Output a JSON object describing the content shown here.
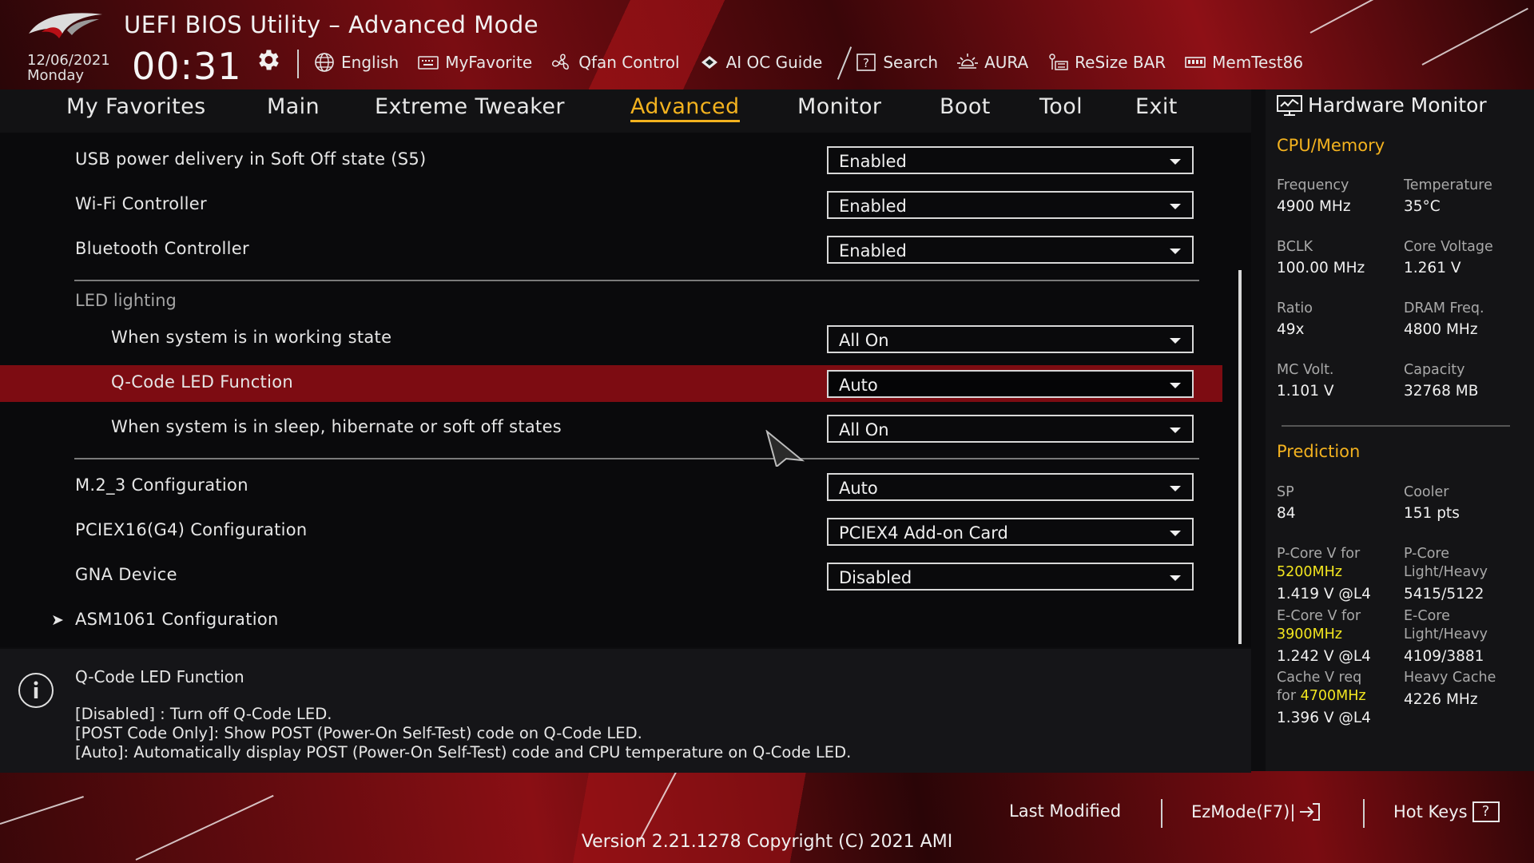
{
  "header": {
    "title": "UEFI BIOS Utility – Advanced Mode",
    "date": "12/06/2021",
    "day": "Monday",
    "time": "00:31",
    "toolbar": [
      {
        "label": "English",
        "icon": "globe-icon"
      },
      {
        "label": "MyFavorite",
        "icon": "keyboard-icon"
      },
      {
        "label": "Qfan Control",
        "icon": "fan-icon"
      },
      {
        "label": "AI OC Guide",
        "icon": "cpu-icon"
      },
      {
        "label": "Search",
        "icon": "question-icon"
      },
      {
        "label": "AURA",
        "icon": "aura-icon"
      },
      {
        "label": "ReSize BAR",
        "icon": "resize-bar-icon"
      },
      {
        "label": "MemTest86",
        "icon": "memory-icon"
      }
    ]
  },
  "nav": {
    "tabs": [
      "My Favorites",
      "Main",
      "Extreme Tweaker",
      "Advanced",
      "Monitor",
      "Boot",
      "Tool",
      "Exit"
    ],
    "active": "Advanced"
  },
  "settings": {
    "usb_power": {
      "label": "USB power delivery in Soft Off state (S5)",
      "value": "Enabled"
    },
    "wifi": {
      "label": "Wi-Fi Controller",
      "value": "Enabled"
    },
    "bluetooth": {
      "label": "Bluetooth Controller",
      "value": "Enabled"
    },
    "led_section": "LED lighting",
    "led_working": {
      "label": "When system is in working state",
      "value": "All On"
    },
    "qcode": {
      "label": "Q-Code LED Function",
      "value": "Auto"
    },
    "led_sleep": {
      "label": "When system is in sleep, hibernate or soft off states",
      "value": "All On"
    },
    "m2_3": {
      "label": "M.2_3 Configuration",
      "value": "Auto"
    },
    "pciex16": {
      "label": "PCIEX16(G4) Configuration",
      "value": "PCIEX4 Add-on Card"
    },
    "gna": {
      "label": "GNA Device",
      "value": "Disabled"
    },
    "asm1061": {
      "label": "ASM1061 Configuration"
    }
  },
  "help": {
    "title": "Q-Code LED Function",
    "lines": [
      "[Disabled] : Turn off Q-Code LED.",
      "[POST Code Only]: Show POST (Power-On Self-Test) code on Q-Code LED.",
      "[Auto]: Automatically display POST (Power-On Self-Test) code and CPU temperature on Q-Code LED."
    ]
  },
  "hardware_monitor": {
    "title": "Hardware Monitor",
    "cpu_memory": {
      "title": "CPU/Memory",
      "frequency": {
        "label": "Frequency",
        "value": "4900 MHz"
      },
      "temperature": {
        "label": "Temperature",
        "value": "35°C"
      },
      "bclk": {
        "label": "BCLK",
        "value": "100.00 MHz"
      },
      "core_voltage": {
        "label": "Core Voltage",
        "value": "1.261 V"
      },
      "ratio": {
        "label": "Ratio",
        "value": "49x"
      },
      "dram_freq": {
        "label": "DRAM Freq.",
        "value": "4800 MHz"
      },
      "mc_volt": {
        "label": "MC Volt.",
        "value": "1.101 V"
      },
      "capacity": {
        "label": "Capacity",
        "value": "32768 MB"
      }
    },
    "prediction": {
      "title": "Prediction",
      "sp": {
        "label": "SP",
        "value": "84"
      },
      "cooler": {
        "label": "Cooler",
        "value": "151 pts"
      },
      "pcore_v": {
        "label": "P-Core V for",
        "freq": "5200MHz",
        "value": "1.419 V @L4"
      },
      "pcore_lh": {
        "label1": "P-Core",
        "label2": "Light/Heavy",
        "value": "5415/5122"
      },
      "ecore_v": {
        "label": "E-Core V for",
        "freq": "3900MHz",
        "value": "1.242 V @L4"
      },
      "ecore_lh": {
        "label1": "E-Core",
        "label2": "Light/Heavy",
        "value": "4109/3881"
      },
      "cache_v": {
        "label1": "Cache V req",
        "label2": "for",
        "freq": "4700MHz",
        "value": "1.396 V @L4"
      },
      "heavy_cache": {
        "label": "Heavy Cache",
        "value": "4226 MHz"
      }
    }
  },
  "footer": {
    "last_modified": "Last Modified",
    "ezmode": "EzMode(F7)|",
    "hotkeys": "Hot Keys",
    "hotkeys_icon_char": "?",
    "version": "Version 2.21.1278 Copyright (C) 2021 AMI"
  },
  "colors": {
    "accent": "#f3b21f",
    "selected_row": "#7d0c12",
    "highlight": "#f3e61f"
  }
}
